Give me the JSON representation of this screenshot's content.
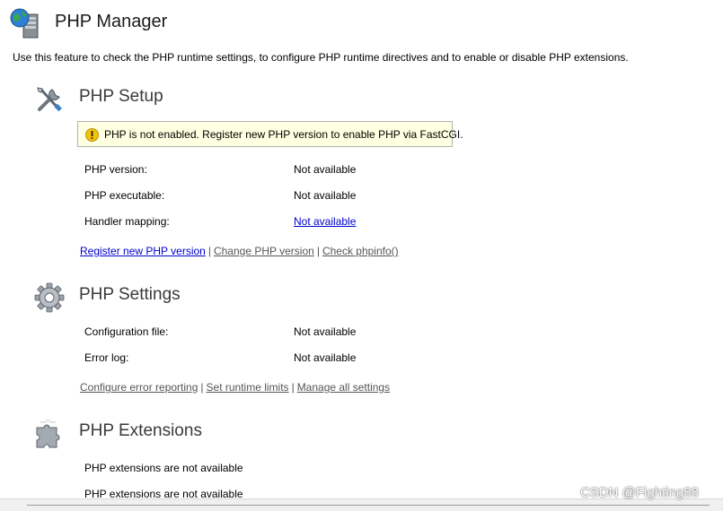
{
  "header": {
    "title": "PHP Manager",
    "description": "Use this feature to check the PHP runtime settings, to configure PHP runtime directives and to enable or disable PHP extensions."
  },
  "setup": {
    "title": "PHP Setup",
    "warning": "PHP is not enabled. Register new PHP version to enable PHP via FastCGI.",
    "rows": [
      {
        "label": "PHP version:",
        "value": "Not available"
      },
      {
        "label": "PHP executable:",
        "value": "Not available"
      },
      {
        "label": "Handler mapping:",
        "value": "Not available"
      }
    ],
    "actions": {
      "register": "Register new PHP version",
      "change": "Change PHP version",
      "phpinfo": "Check phpinfo()",
      "separator": "|"
    }
  },
  "settings": {
    "title": "PHP Settings",
    "rows": [
      {
        "label": "Configuration file:",
        "value": "Not available"
      },
      {
        "label": "Error log:",
        "value": "Not available"
      }
    ],
    "actions": {
      "error_reporting": "Configure error reporting",
      "runtime_limits": "Set runtime limits",
      "manage_all": "Manage all settings",
      "separator": "|"
    }
  },
  "extensions": {
    "title": "PHP Extensions",
    "lines": [
      "PHP extensions are not available",
      "PHP extensions are not available"
    ]
  },
  "watermark": "CSDN @Fighting88",
  "colors": {
    "link": "#0000cc",
    "link_disabled": "#555555",
    "warning_bg": "#ffffe1",
    "warning_icon": "#f5c400"
  },
  "icons": {
    "app": "globe-server-icon",
    "setup": "wrench-screwdriver-icon",
    "settings": "gear-icon",
    "extensions": "puzzle-piece-icon",
    "warning": "warning-icon"
  }
}
